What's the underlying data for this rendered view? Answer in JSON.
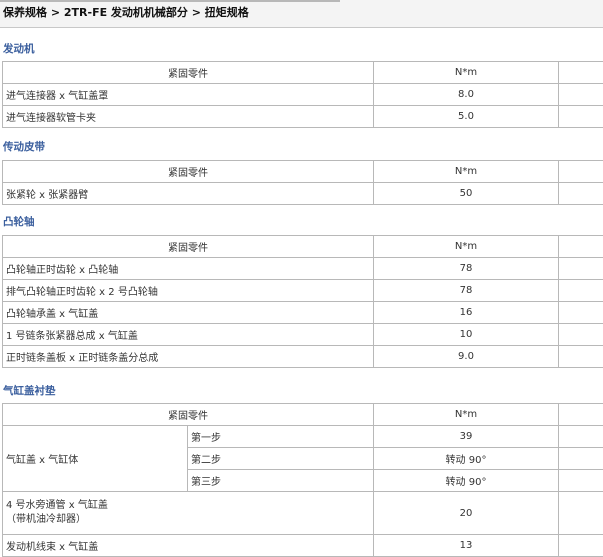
{
  "breadcrumb": "保养规格 > 2TR-FE 发动机机械部分 > 扭矩规格",
  "header": {
    "part": "紧固零件",
    "unit": "N*m"
  },
  "sections": [
    {
      "title": "发动机",
      "rows": [
        {
          "part": "进气连接器 x 气缸盖罩",
          "value": "8.0"
        },
        {
          "part": "进气连接器软管卡夹",
          "value": "5.0"
        }
      ]
    },
    {
      "title": "传动皮带",
      "rows": [
        {
          "part": "张紧轮 x 张紧器臂",
          "value": "50"
        }
      ]
    },
    {
      "title": "凸轮轴",
      "rows": [
        {
          "part": "凸轮轴正时齿轮 x 凸轮轴",
          "value": "78"
        },
        {
          "part": "排气凸轮轴正时齿轮 x 2 号凸轮轴",
          "value": "78"
        },
        {
          "part": "凸轮轴承盖 x 气缸盖",
          "value": "16"
        },
        {
          "part": "1 号链条张紧器总成 x 气缸盖",
          "value": "10"
        },
        {
          "part": "正时链条盖板 x 正时链条盖分总成",
          "value": "9.0"
        }
      ]
    },
    {
      "title": "气缸盖衬垫",
      "group": {
        "part": "气缸盖 x 气缸体",
        "steps": [
          {
            "step": "第一步",
            "value": "39"
          },
          {
            "step": "第二步",
            "value": "转动 90°"
          },
          {
            "step": "第三步",
            "value": "转动 90°"
          }
        ]
      },
      "rows": [
        {
          "part_line1": "4 号水旁通管 x 气缸盖",
          "part_line2": "（带机油冷却器）",
          "value": "20"
        },
        {
          "part": "发动机线束 x 气缸盖",
          "value": "13"
        }
      ]
    }
  ]
}
